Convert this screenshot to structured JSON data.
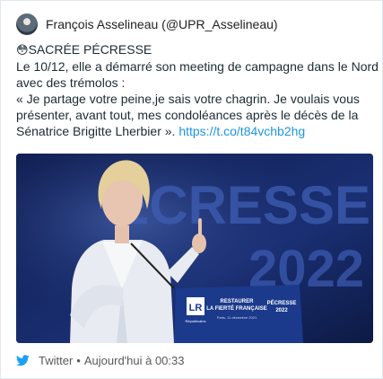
{
  "tweet": {
    "author_line": "François Asselineau (@UPR_Asselineau)",
    "emoji": "😳",
    "lines": [
      "SACRÉE PÉCRESSE",
      "Le 10/12, elle a démarré son meeting de campagne dans le Nord",
      "avec des trémolos :",
      "« Je partage votre peine,je sais votre chagrin. Je voulais vous",
      "présenter, avant tout, mes condoléances après le décès de la",
      "Sénatrice Brigitte Lherbier »."
    ],
    "link": "https://t.co/t84vchb2hg",
    "media": {
      "backdrop_lines": [
        "ÉCRESSE",
        "2022"
      ],
      "lectern": {
        "party_mark": "LR",
        "party_sub": "Républicains",
        "slogan_1": "RESTAURER",
        "slogan_2": "LA FIERTÉ FRANÇAISE",
        "place_date": "Paris, 11 décembre 2021",
        "name_small": "PÉCRESSE",
        "year_small": "2022"
      }
    }
  },
  "footer": {
    "source": "Twitter",
    "separator": "•",
    "time": "Aujourd'hui à 00:33"
  },
  "colors": {
    "link": "#1b95e0",
    "twitter_blue": "#1da1f2",
    "stage_blue": "#14245c"
  }
}
